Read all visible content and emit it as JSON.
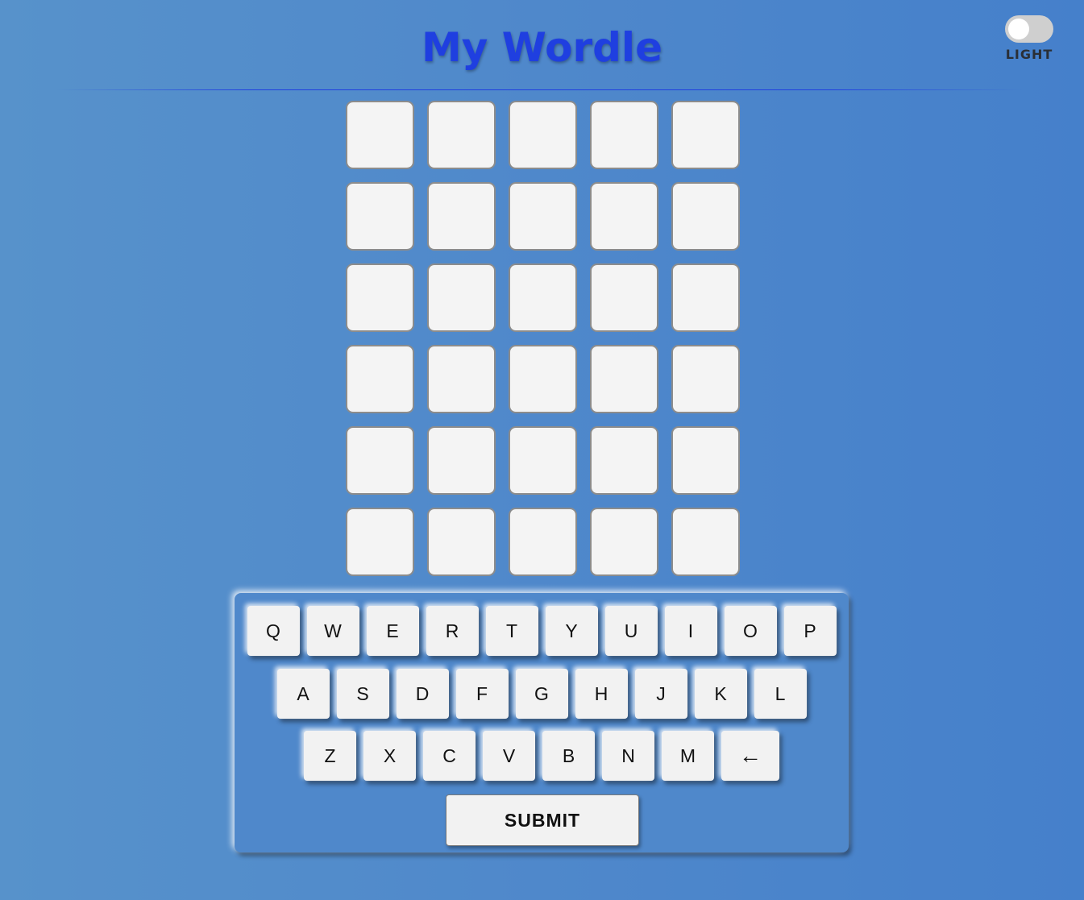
{
  "header": {
    "title": "My Wordle",
    "theme_label": "LIGHT",
    "theme_dark": false
  },
  "board": {
    "rows": [
      [
        "",
        "",
        "",
        "",
        ""
      ],
      [
        "",
        "",
        "",
        "",
        ""
      ],
      [
        "",
        "",
        "",
        "",
        ""
      ],
      [
        "",
        "",
        "",
        "",
        ""
      ],
      [
        "",
        "",
        "",
        "",
        ""
      ],
      [
        "",
        "",
        "",
        "",
        ""
      ]
    ]
  },
  "keyboard": {
    "rows": [
      [
        "Q",
        "W",
        "E",
        "R",
        "T",
        "Y",
        "U",
        "I",
        "O",
        "P"
      ],
      [
        "A",
        "S",
        "D",
        "F",
        "G",
        "H",
        "J",
        "K",
        "L"
      ],
      [
        "Z",
        "X",
        "C",
        "V",
        "B",
        "N",
        "M",
        "←"
      ]
    ],
    "submit_label": "SUBMIT"
  },
  "colors": {
    "title": "#1f3fe0",
    "background": "#4f88cb",
    "tile": "#f4f4f4",
    "key": "#f2f2f2"
  }
}
